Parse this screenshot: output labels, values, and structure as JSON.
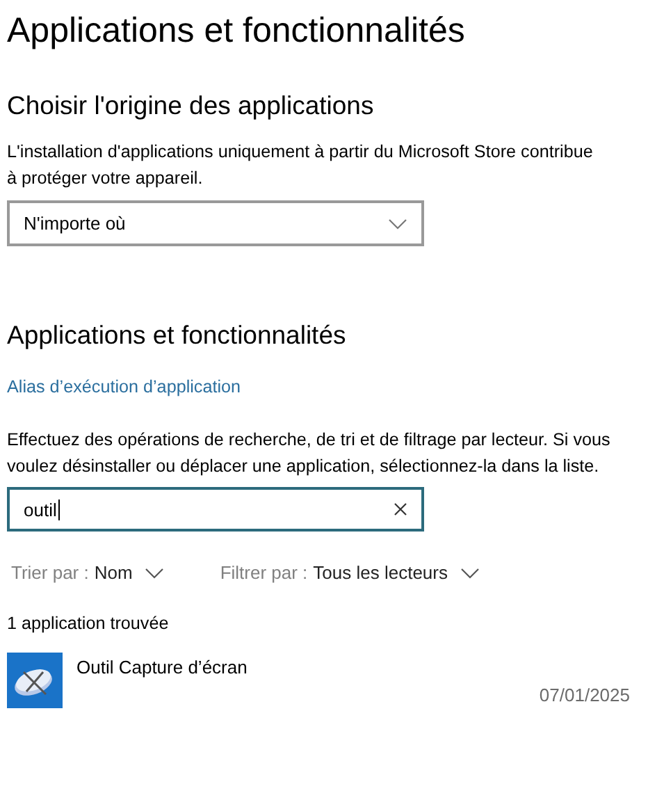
{
  "page_title": "Applications et fonctionnalités",
  "source_section": {
    "heading": "Choisir l'origine des applications",
    "description": "L'installation d'applications uniquement à partir du Microsoft Store contribue à protéger votre appareil.",
    "dropdown": {
      "value": "N'importe où"
    }
  },
  "apps_section": {
    "heading": "Applications et fonctionnalités",
    "link": "Alias d’exécution d’application",
    "description": "Effectuez des opérations de recherche, de tri et de filtrage par lecteur. Si vous voulez désinstaller ou déplacer une application, sélectionnez-la dans la liste.",
    "search": {
      "value": "outil",
      "focused": true
    },
    "sort": {
      "label": "Trier par :",
      "value": "Nom"
    },
    "filter": {
      "label": "Filtrer par :",
      "value": "Tous les lecteurs"
    },
    "result_count": "1 application trouvée",
    "apps": [
      {
        "name": "Outil Capture d’écran",
        "date": "07/01/2025"
      }
    ]
  }
}
